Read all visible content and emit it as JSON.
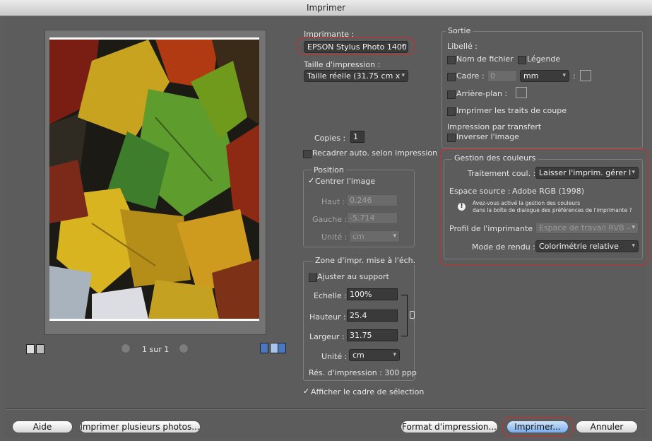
{
  "window": {
    "title": "Imprimer"
  },
  "preview": {
    "page_indicator": "1 sur 1"
  },
  "printer": {
    "label": "Imprimante :",
    "value": "EPSON Stylus Photo 1400",
    "size_label": "Taille d'impression :",
    "size_value": "Taille réelle (31.75 cm x",
    "copies_label": "Copies :",
    "copies_value": "1",
    "recadrer_label": "Recadrer auto. selon impression"
  },
  "position": {
    "title": "Position",
    "centrer_label": "Centrer l'image",
    "haut_label": "Haut :",
    "haut_value": "0.246",
    "gauche_label": "Gauche :",
    "gauche_value": "-5.714",
    "unite_label": "Unité :",
    "unite_value": "cm"
  },
  "zone": {
    "title": "Zone d'impr. mise à l'éch.",
    "ajuster_label": "Ajuster au support",
    "echelle_label": "Echelle :",
    "echelle_value": "100%",
    "hauteur_label": "Hauteur :",
    "hauteur_value": "25.4",
    "largeur_label": "Largeur :",
    "largeur_value": "31.75",
    "unite_label": "Unité :",
    "unite_value": "cm",
    "resolution": "Rés. d'impression : 300 ppp"
  },
  "afficher_cadre_label": "Afficher le cadre de sélection",
  "sortie": {
    "title": "Sortie",
    "libelle_label": "Libellé :",
    "nom_fichier_label": "Nom de fichier",
    "legende_label": "Légende",
    "cadre_label": "Cadre :",
    "cadre_value": "0",
    "cadre_unit": "mm",
    "arriere_plan_label": "Arrière-plan :",
    "traits_coupe_label": "Imprimer les traits de coupe",
    "transfert_label": "Impression par transfert",
    "inverser_label": "Inverser l'image"
  },
  "couleurs": {
    "title": "Gestion des couleurs",
    "traitement_label": "Traitement coul. :",
    "traitement_value": "Laisser l'imprim. gérer l",
    "espace_label": "Espace source :",
    "espace_value": "Adobe RGB (1998)",
    "warning_line1": "Avez-vous activé la gestion des couleurs",
    "warning_line2": "dans la boîte de dialogue des préférences de l'imprimante ?",
    "profil_label": "Profil de l'imprimante :",
    "profil_value": "Espace de travail RVB –",
    "mode_label": "Mode de rendu :",
    "mode_value": "Colorimétrie relative"
  },
  "buttons": {
    "aide": "Aide",
    "plusieurs": "Imprimer plusieurs photos...",
    "format": "Format d'impression...",
    "imprimer": "Imprimer...",
    "annuler": "Annuler"
  },
  "colors": {
    "highlight": "#d32a2a",
    "default_button": "#78acea"
  }
}
